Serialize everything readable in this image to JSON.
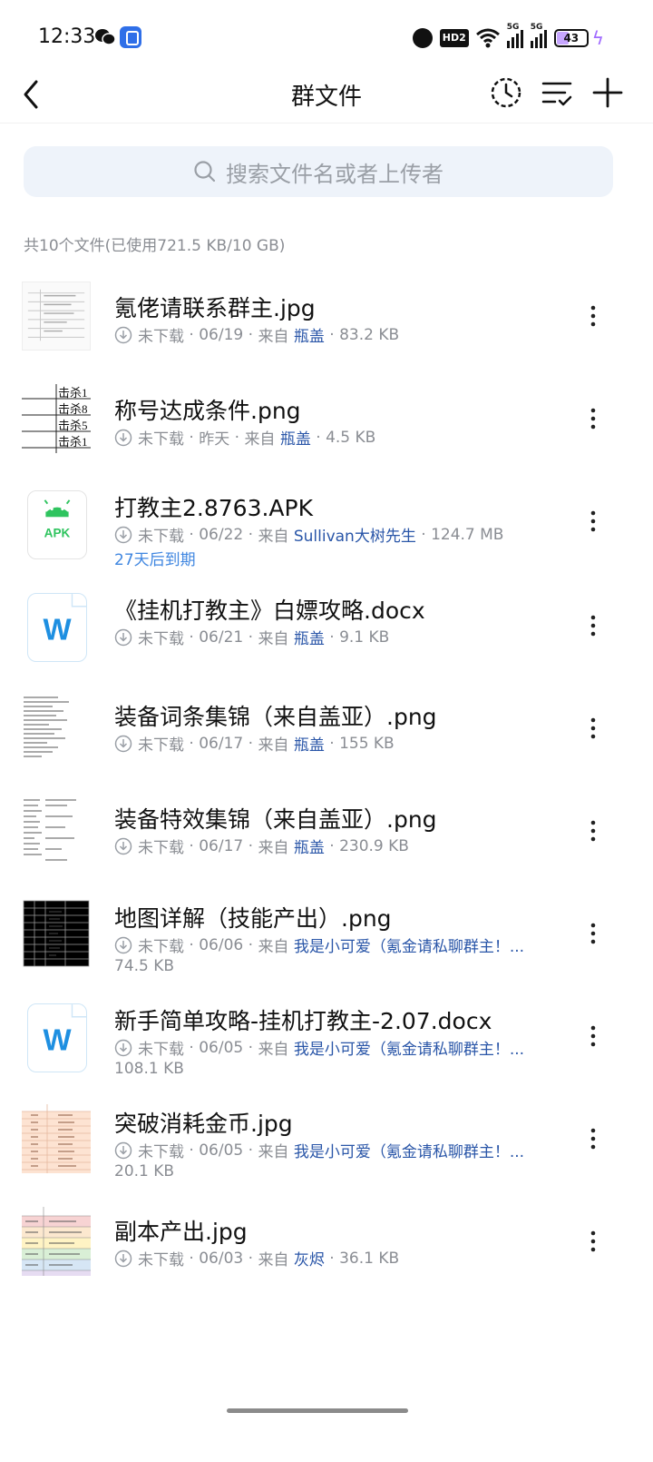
{
  "status_bar": {
    "time": "12:33",
    "battery": "43",
    "hd": "HD2",
    "net1": "5G",
    "net2": "5G"
  },
  "header": {
    "title": "群文件"
  },
  "search": {
    "placeholder": "搜索文件名或者上传者"
  },
  "summary": "共10个文件(已使用721.5 KB/10 GB)",
  "files": [
    {
      "name": "氪佬请联系群主.jpg",
      "status": "未下载",
      "date": "06/19",
      "from_label": "来自",
      "uploader": "瓶盖",
      "size": "83.2 KB",
      "thumb": "doc-image"
    },
    {
      "name": "称号达成条件.png",
      "status": "未下载",
      "date": "昨天",
      "from_label": "来自",
      "uploader": "瓶盖",
      "size": "4.5 KB",
      "thumb": "table-image",
      "thumb_text": [
        "击杀1",
        "击杀8",
        "击杀5",
        "击杀1"
      ]
    },
    {
      "name": "打教主2.8763.APK",
      "status": "未下载",
      "date": "06/22",
      "from_label": "来自",
      "uploader": "Sullivan大树先生",
      "size": "124.7 MB",
      "expire": "27天后到期",
      "thumb": "apk",
      "thumb_label": "APK"
    },
    {
      "name": "《挂机打教主》白嫖攻略.docx",
      "status": "未下载",
      "date": "06/21",
      "from_label": "来自",
      "uploader": "瓶盖",
      "size": "9.1 KB",
      "thumb": "word",
      "thumb_label": "W"
    },
    {
      "name": "装备词条集锦（来自盖亚）.png",
      "status": "未下载",
      "date": "06/17",
      "from_label": "来自",
      "uploader": "瓶盖",
      "size": "155 KB",
      "thumb": "text-image"
    },
    {
      "name": "装备特效集锦（来自盖亚）.png",
      "status": "未下载",
      "date": "06/17",
      "from_label": "来自",
      "uploader": "瓶盖",
      "size": "230.9 KB",
      "thumb": "text-image"
    },
    {
      "name": "地图详解（技能产出）.png",
      "status": "未下载",
      "date": "06/06",
      "from_label": "来自",
      "uploader": "我是小可爱（氪金请私聊群主！...",
      "size": "74.5 KB",
      "thumb": "grid-image"
    },
    {
      "name": "新手简单攻略-挂机打教主-2.07.docx",
      "status": "未下载",
      "date": "06/05",
      "from_label": "来自",
      "uploader": "我是小可爱（氪金请私聊群主！...",
      "size": "108.1 KB",
      "thumb": "word",
      "thumb_label": "W"
    },
    {
      "name": "突破消耗金币.jpg",
      "status": "未下载",
      "date": "06/05",
      "from_label": "来自",
      "uploader": "我是小可爱（氪金请私聊群主！...",
      "size": "20.1 KB",
      "thumb": "orange-table"
    },
    {
      "name": "副本产出.jpg",
      "status": "未下载",
      "date": "06/03",
      "from_label": "来自",
      "uploader": "灰烬",
      "size": "36.1 KB",
      "thumb": "color-table"
    }
  ],
  "colors": {
    "accent": "#2a56a8",
    "expire": "#3f86e0",
    "search_bg": "#eef3fa",
    "apk_green": "#2fc45f",
    "word_blue": "#1e8fe1"
  }
}
